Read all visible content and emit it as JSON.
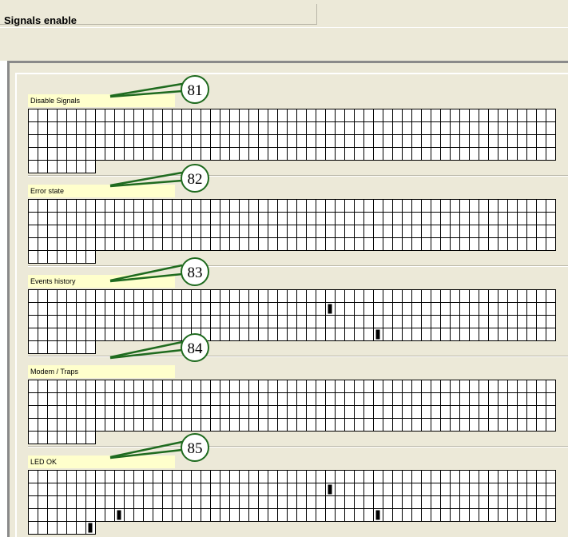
{
  "window": {
    "title": "Signals enable"
  },
  "groups": [
    {
      "label": "Disable Signals",
      "callout": "81",
      "marks": []
    },
    {
      "label": "Error state",
      "callout": "82",
      "marks": []
    },
    {
      "label": "Events history",
      "callout": "83",
      "marks": [
        [
          1,
          31
        ],
        [
          3,
          36
        ]
      ]
    },
    {
      "label": "Modem / Traps",
      "callout": "84",
      "marks": []
    },
    {
      "label": "LED OK",
      "callout": "85",
      "marks": [
        [
          1,
          31
        ],
        [
          3,
          9
        ],
        [
          3,
          36
        ],
        [
          4,
          6
        ]
      ]
    }
  ],
  "grid": {
    "columns": 55,
    "rows": 4,
    "extra_row_columns": 7
  },
  "colors": {
    "callout_green": "#1f6b1f",
    "label_bg": "#ffffcc",
    "panel_bg": "#ece9d8"
  }
}
